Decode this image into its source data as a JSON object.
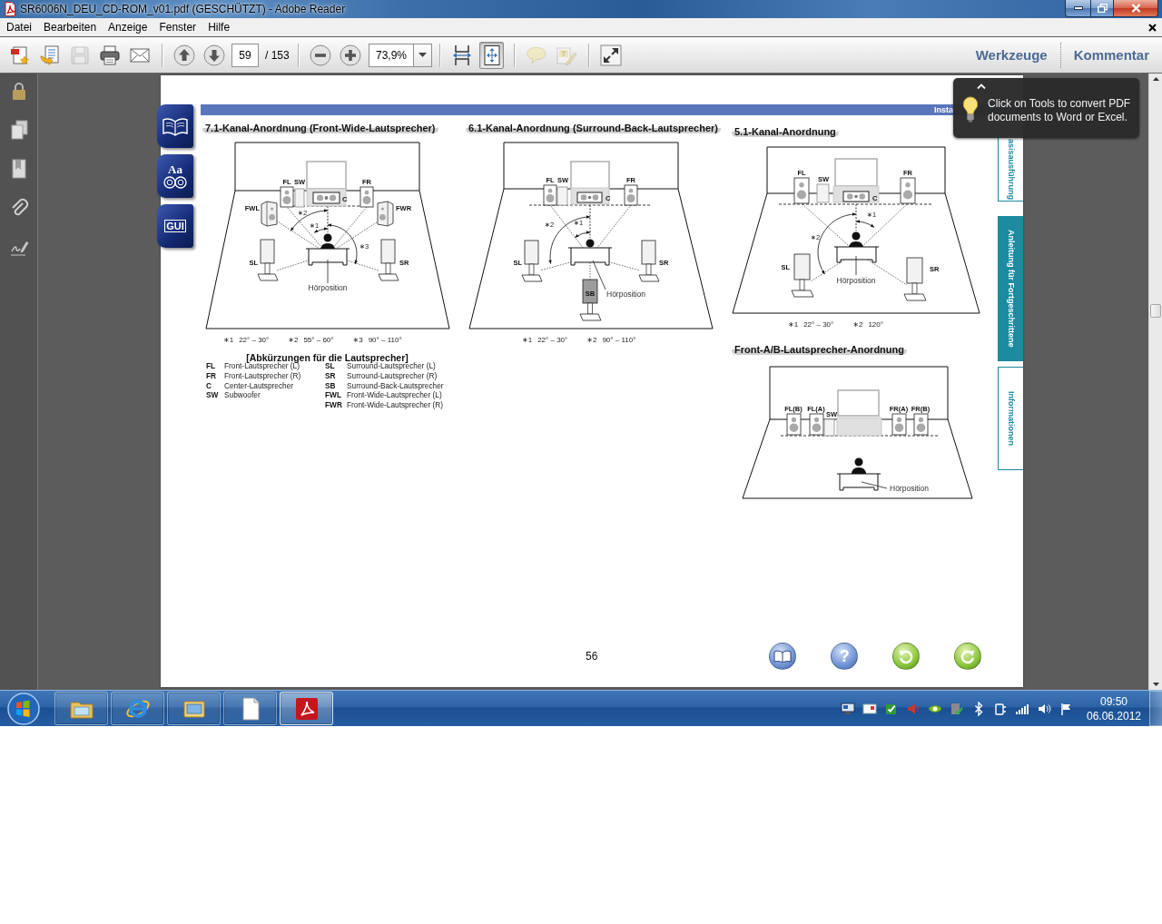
{
  "window": {
    "title": "SR6006N_DEU_CD-ROM_v01.pdf (GESCHÜTZT) - Adobe Reader"
  },
  "menu": {
    "items": [
      "Datei",
      "Bearbeiten",
      "Anzeige",
      "Fenster",
      "Hilfe"
    ]
  },
  "toolbar": {
    "tools": [
      {
        "kind": "create",
        "disabled": false,
        "pressed": false
      },
      {
        "kind": "share",
        "disabled": false,
        "pressed": false
      },
      {
        "kind": "save",
        "disabled": true,
        "pressed": false
      },
      {
        "kind": "print",
        "disabled": false,
        "pressed": false
      },
      {
        "kind": "email",
        "disabled": false,
        "pressed": false
      },
      {
        "kind": "separator"
      },
      {
        "kind": "previous",
        "disabled": false,
        "pressed": false
      },
      {
        "kind": "next",
        "disabled": false,
        "pressed": false
      },
      {
        "kind": "page-field",
        "value": "59"
      },
      {
        "kind": "page-count",
        "text": "/ 153"
      },
      {
        "kind": "separator"
      },
      {
        "kind": "zoom-out",
        "disabled": false,
        "pressed": false
      },
      {
        "kind": "zoom-in",
        "disabled": false,
        "pressed": false
      },
      {
        "kind": "zoom-field",
        "value": "73,9%"
      },
      {
        "kind": "separator"
      },
      {
        "kind": "fit-width",
        "disabled": false,
        "pressed": false
      },
      {
        "kind": "fit-page",
        "disabled": false,
        "pressed": true
      },
      {
        "kind": "separator"
      },
      {
        "kind": "comment",
        "disabled": true,
        "pressed": false
      },
      {
        "kind": "sign",
        "disabled": true,
        "pressed": false
      },
      {
        "kind": "separator"
      },
      {
        "kind": "full-screen",
        "disabled": false,
        "pressed": false
      }
    ],
    "panels": [
      {
        "label": "Werkzeuge"
      },
      {
        "label": "Kommentar"
      }
    ]
  },
  "tooltip": {
    "text": "Click on Tools to convert PDF documents to Word or Excel."
  },
  "page": {
    "section_label": "Insta",
    "nav_tabs": [
      {
        "kind": "book"
      },
      {
        "kind": "glossary",
        "label": "Aa"
      },
      {
        "kind": "gui",
        "label": "GUI"
      }
    ],
    "side_tabs": [
      {
        "label": "asisausführung",
        "selected": false
      },
      {
        "label": "Anleitung für Fortgeschrittene",
        "selected": true
      },
      {
        "label": "Informationen",
        "selected": false
      }
    ],
    "diagrams": [
      {
        "kind": "frontwide",
        "title": "7.1-Kanal-Anordnung (Front-Wide-Lautsprecher)",
        "speakers": [
          "FL",
          "SW",
          "FR",
          "C",
          "FWL",
          "FWR",
          "SL",
          "SR"
        ],
        "angle_marks": [
          "∗2",
          "∗1",
          "∗3"
        ],
        "listener_label": "Hörposition",
        "notes": [
          {
            "mark": "∗1",
            "range": "22° – 30°"
          },
          {
            "mark": "∗2",
            "range": "55° – 60°"
          },
          {
            "mark": "∗3",
            "range": "90° – 110°"
          }
        ]
      },
      {
        "kind": "surroundback",
        "title": "6.1-Kanal-Anordnung (Surround-Back-Lautsprecher)",
        "speakers": [
          "FL",
          "SW",
          "FR",
          "C",
          "SL",
          "SR",
          "SB"
        ],
        "angle_marks": [
          "∗2",
          "∗1"
        ],
        "listener_label": "Hörposition",
        "notes": [
          {
            "mark": "∗1",
            "range": "22° – 30°"
          },
          {
            "mark": "∗2",
            "range": "90° – 110°"
          }
        ]
      },
      {
        "kind": "fivechannel",
        "title": "5.1-Kanal-Anordnung",
        "speakers": [
          "FL",
          "FR",
          "SW",
          "C",
          "SL",
          "SR"
        ],
        "angle_marks": [
          "∗1",
          "∗2"
        ],
        "listener_label": "Hörposition",
        "notes": [
          {
            "mark": "∗1",
            "range": "22° – 30°"
          },
          {
            "mark": "∗2",
            "range": "120°"
          }
        ]
      },
      {
        "kind": "frontab",
        "title": "Front-A/B-Lautsprecher-Anordnung",
        "speakers": [
          "FL(B)",
          "FL(A)",
          "FR(A)",
          "FR(B)",
          "SW"
        ],
        "listener_label": "Hörposition"
      }
    ],
    "abbreviations": {
      "title": "[Abkürzungen für die Lautsprecher]",
      "columns": [
        [
          {
            "code": "FL",
            "text": "Front-Lautsprecher (L)"
          },
          {
            "code": "FR",
            "text": "Front-Lautsprecher (R)"
          },
          {
            "code": "C",
            "text": "Center-Lautsprecher"
          },
          {
            "code": "SW",
            "text": "Subwoofer"
          }
        ],
        [
          {
            "code": "SL",
            "text": "Surround-Lautsprecher (L)"
          },
          {
            "code": "SR",
            "text": "Surround-Lautsprecher (R)"
          },
          {
            "code": "SB",
            "text": "Surround-Back-Lautsprecher"
          },
          {
            "code": "FWL",
            "text": "Front-Wide-Lautsprecher (L)"
          },
          {
            "code": "FWR",
            "text": "Front-Wide-Lautsprecher (R)"
          }
        ]
      ]
    },
    "page_number": "56",
    "footer_buttons": [
      {
        "kind": "contents"
      },
      {
        "kind": "help",
        "label": "?"
      },
      {
        "kind": "back"
      },
      {
        "kind": "forward"
      }
    ]
  },
  "taskbar": {
    "apps": [
      {
        "kind": "explorer",
        "active": false
      },
      {
        "kind": "browser",
        "active": false
      },
      {
        "kind": "library",
        "active": false
      },
      {
        "kind": "document",
        "active": false
      },
      {
        "kind": "reader",
        "active": true
      }
    ],
    "time": "09:50",
    "date": "06.06.2012"
  }
}
